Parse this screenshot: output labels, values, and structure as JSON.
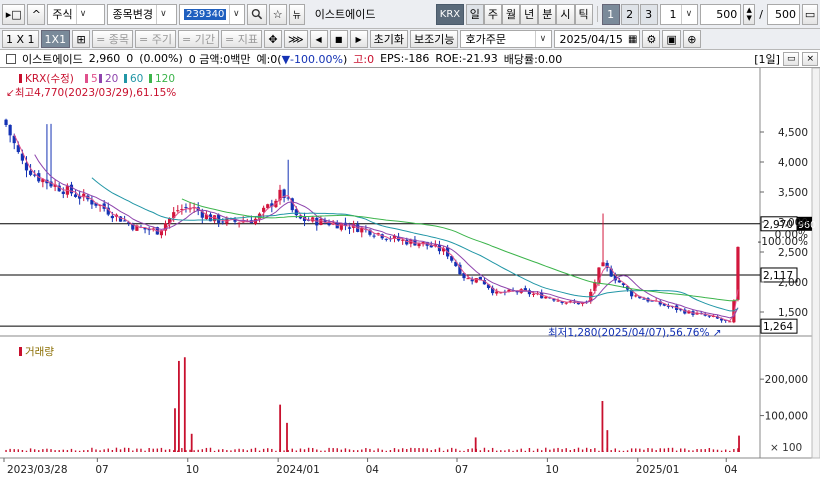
{
  "toolbar": {
    "menu_toggle": "▸□",
    "nav_up": "^",
    "market_select": "주식",
    "stock_change_select": "종목변경",
    "stock_code": "239340",
    "stock_name": "이스트에이드",
    "exchange_badge": "KRX",
    "period_buttons": [
      "일",
      "주",
      "월",
      "년",
      "분",
      "시",
      "틱"
    ],
    "active_period": "일",
    "number_buttons": [
      "1",
      "2",
      "3"
    ],
    "active_number": "1",
    "interval_value": "1",
    "count_value": "500",
    "slash": "/",
    "total_value": "500"
  },
  "toolbar2": {
    "layout_1x1": "1 X 1",
    "layout_1x1_alt": "1X1",
    "btn_stock": "= 종목",
    "btn_period": "= 주기",
    "btn_range": "= 기간",
    "btn_indicator": "= 지표",
    "reset": "초기화",
    "aux": "보조기능",
    "order": "호가주문",
    "date": "2025/04/15"
  },
  "stock_info": {
    "name": "이스트에이드",
    "price": "2,960",
    "change": "0",
    "change_pct": "(0.00%)",
    "amount_label": "0 금액:0백만",
    "pre_label": "예:0(",
    "pre_change": "▼-100.00%",
    "pre_close": ")",
    "high_label": "고:0",
    "eps": "EPS:-186",
    "roe": "ROE:-21.93",
    "dividend": "배당률:0.00",
    "period_badge": "[1일]"
  },
  "legend": {
    "title": "KRX(수정)",
    "ma5": "5",
    "ma20": "20",
    "ma60": "60",
    "ma120": "120",
    "max_note": "최고4,770(2023/03/29),61.15%",
    "min_note": "최저1,280(2025/04/07),56.76%",
    "volume_title": "거래량",
    "volume_unit": "× 100"
  },
  "price_axis": {
    "ticks": [
      "4,500",
      "4,000",
      "3,500",
      "3,000",
      "2,500",
      "2,000",
      "1,500"
    ],
    "pct_ticks": [
      "0.00%",
      "-100.00%"
    ],
    "label_current": "2,970",
    "label_current_tail": "960",
    "label_line2": "2,117",
    "label_min": "1,264"
  },
  "volume_axis": {
    "ticks": [
      "200,000",
      "100,000"
    ]
  },
  "x_axis": {
    "ticks": [
      "2023/03/28",
      "07",
      "10",
      "2024/01",
      "04",
      "07",
      "10",
      "2025/01",
      "04"
    ]
  },
  "colors": {
    "up": "#d2163c",
    "down": "#1432b4",
    "ma5": "#e0508c",
    "ma20": "#8e44ad",
    "ma60": "#2196a6",
    "ma120": "#3cb44b",
    "volume": "#c8102e"
  },
  "chart_data": {
    "type": "candlestick",
    "title": "",
    "price_range": [
      1200,
      4900
    ],
    "volume_range": [
      0,
      280000
    ],
    "hlines": [
      2970,
      2117,
      1264
    ],
    "series_close": [
      [
        "2023/03/28",
        4700
      ],
      [
        "2023/04/15",
        4000
      ],
      [
        "2023/05/01",
        3750
      ],
      [
        "2023/05/20",
        3600
      ],
      [
        "2023/06/10",
        3450
      ],
      [
        "2023/07/01",
        3300
      ],
      [
        "2023/07/20",
        3100
      ],
      [
        "2023/08/10",
        2900
      ],
      [
        "2023/09/01",
        2850
      ],
      [
        "2023/09/20",
        3200
      ],
      [
        "2023/10/05",
        3250
      ],
      [
        "2023/10/25",
        3050
      ],
      [
        "2023/11/15",
        3000
      ],
      [
        "2023/12/10",
        3050
      ],
      [
        "2024/01/05",
        3500
      ],
      [
        "2024/01/20",
        3050
      ],
      [
        "2024/02/15",
        3000
      ],
      [
        "2024/03/10",
        2950
      ],
      [
        "2024/04/05",
        2850
      ],
      [
        "2024/05/01",
        2700
      ],
      [
        "2024/05/25",
        2650
      ],
      [
        "2024/06/20",
        2500
      ],
      [
        "2024/07/10",
        2050
      ],
      [
        "2024/07/25",
        2050
      ],
      [
        "2024/08/10",
        1800
      ],
      [
        "2024/09/01",
        1850
      ],
      [
        "2024/10/01",
        1750
      ],
      [
        "2024/10/25",
        1650
      ],
      [
        "2024/11/10",
        1650
      ],
      [
        "2024/11/25",
        2300
      ],
      [
        "2024/12/10",
        2050
      ],
      [
        "2024/12/25",
        1800
      ],
      [
        "2025/01/20",
        1650
      ],
      [
        "2025/02/20",
        1500
      ],
      [
        "2025/03/20",
        1400
      ],
      [
        "2025/04/07",
        1300
      ],
      [
        "2025/04/15",
        2960
      ]
    ],
    "volume_spikes": [
      [
        "2023/09/18",
        120000
      ],
      [
        "2023/09/22",
        250000
      ],
      [
        "2023/09/28",
        260000
      ],
      [
        "2023/10/05",
        50000
      ],
      [
        "2024/01/03",
        130000
      ],
      [
        "2024/01/10",
        80000
      ],
      [
        "2024/07/20",
        40000
      ],
      [
        "2024/11/26",
        140000
      ],
      [
        "2024/12/01",
        60000
      ],
      [
        "2025/04/14",
        45000
      ]
    ]
  }
}
